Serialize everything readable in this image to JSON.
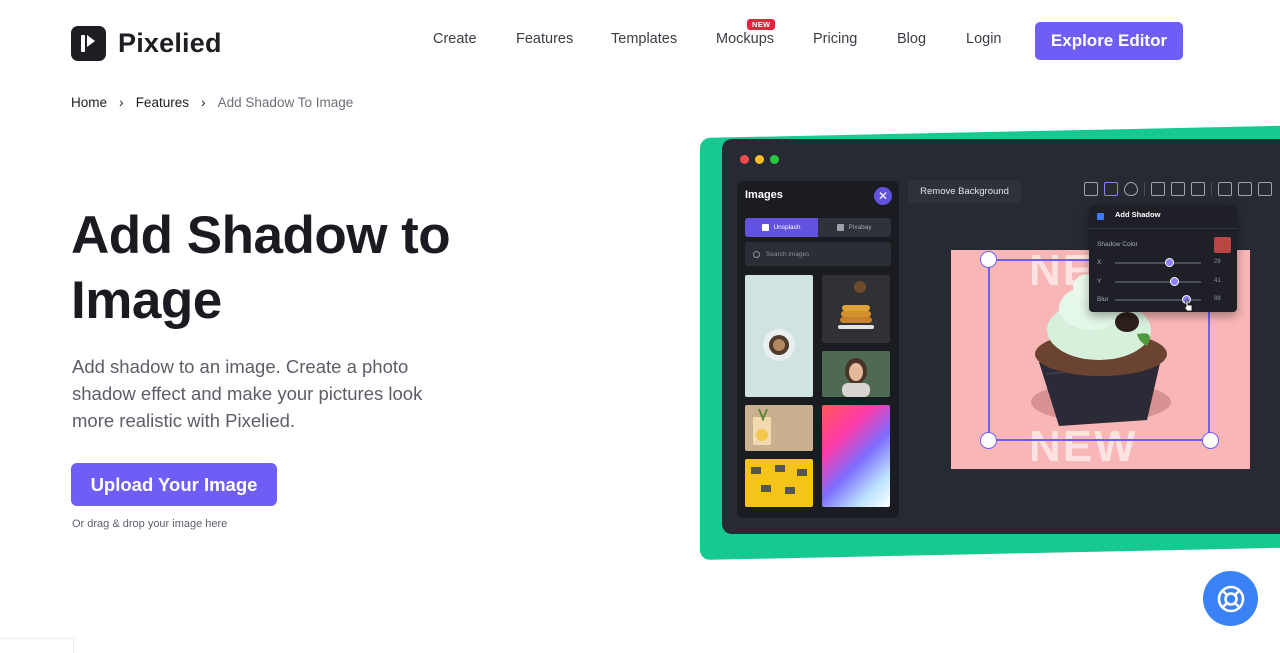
{
  "brand": {
    "name": "Pixelied"
  },
  "nav": {
    "items": [
      "Create",
      "Features",
      "Templates",
      "Mockups",
      "Pricing",
      "Blog",
      "Login"
    ],
    "badge": "NEW",
    "cta": "Explore Editor"
  },
  "breadcrumb": [
    "Home",
    "Features",
    "Add Shadow To Image"
  ],
  "hero": {
    "title": "Add Shadow to Image",
    "description": "Add shadow to an image. Create a photo shadow effect and make your pictures look more realistic with Pixelied.",
    "upload_label": "Upload Your Image",
    "drag_hint": "Or drag & drop your image here"
  },
  "editor": {
    "panel_title": "Images",
    "close": "✕",
    "sources": [
      "Unsplash",
      "Pixabay"
    ],
    "search_placeholder": "Search images",
    "remove_bg": "Remove Background",
    "canvas_text": [
      "NEW",
      "NEW"
    ],
    "shadow": {
      "title": "Add Shadow",
      "color_label": "Shadow Color",
      "color": "#b94645",
      "sliders": [
        {
          "label": "X",
          "value": "28",
          "level": 0.63
        },
        {
          "label": "Y",
          "value": "41",
          "level": 0.69
        },
        {
          "label": "Blur",
          "value": "88",
          "level": 0.83
        }
      ]
    }
  },
  "colors": {
    "accent": "#6f5ef5",
    "green": "#16c991",
    "editor_bg": "#282a33",
    "help": "#3b82f6"
  }
}
